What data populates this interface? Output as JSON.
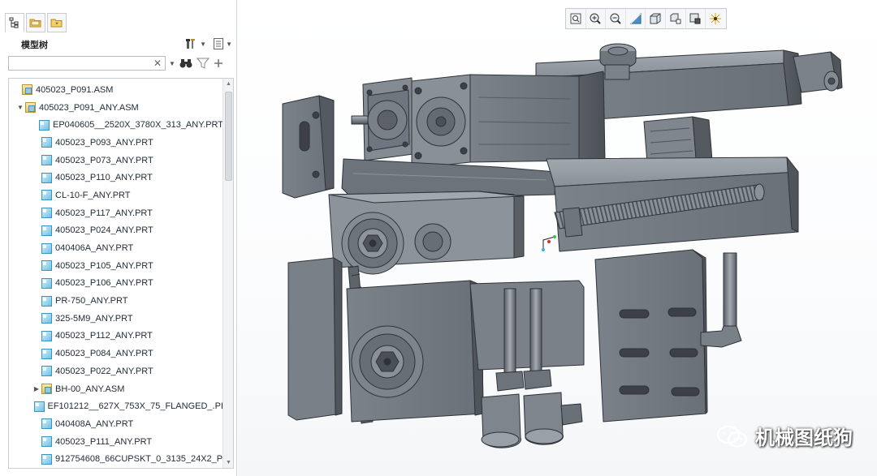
{
  "panel": {
    "tree_title": "模型树",
    "search_placeholder": "",
    "tabs": [
      {
        "icon": "model-tree-icon",
        "active": true
      },
      {
        "icon": "folder-browser-icon",
        "active": false
      },
      {
        "icon": "favorites-icon",
        "active": false
      }
    ]
  },
  "tree": {
    "items": [
      {
        "label": "405023_P091.ASM",
        "type": "asm",
        "level": 0,
        "twisty": ""
      },
      {
        "label": "405023_P091_ANY.ASM",
        "type": "asm",
        "level": 1,
        "twisty": "expanded"
      },
      {
        "label": "EP040605__2520X_3780X_313_ANY.PRT",
        "type": "prt",
        "level": 2,
        "twisty": ""
      },
      {
        "label": "405023_P093_ANY.PRT",
        "type": "prt",
        "level": 2,
        "twisty": ""
      },
      {
        "label": "405023_P073_ANY.PRT",
        "type": "prt",
        "level": 2,
        "twisty": ""
      },
      {
        "label": "405023_P110_ANY.PRT",
        "type": "prt",
        "level": 2,
        "twisty": ""
      },
      {
        "label": "CL-10-F_ANY.PRT",
        "type": "prt",
        "level": 2,
        "twisty": ""
      },
      {
        "label": "405023_P117_ANY.PRT",
        "type": "prt",
        "level": 2,
        "twisty": ""
      },
      {
        "label": "405023_P024_ANY.PRT",
        "type": "prt",
        "level": 2,
        "twisty": ""
      },
      {
        "label": "040406A_ANY.PRT",
        "type": "prt",
        "level": 2,
        "twisty": ""
      },
      {
        "label": "405023_P105_ANY.PRT",
        "type": "prt",
        "level": 2,
        "twisty": ""
      },
      {
        "label": "405023_P106_ANY.PRT",
        "type": "prt",
        "level": 2,
        "twisty": ""
      },
      {
        "label": "PR-750_ANY.PRT",
        "type": "prt",
        "level": 2,
        "twisty": ""
      },
      {
        "label": "325-5M9_ANY.PRT",
        "type": "prt",
        "level": 2,
        "twisty": ""
      },
      {
        "label": "405023_P112_ANY.PRT",
        "type": "prt",
        "level": 2,
        "twisty": ""
      },
      {
        "label": "405023_P084_ANY.PRT",
        "type": "prt",
        "level": 2,
        "twisty": ""
      },
      {
        "label": "405023_P022_ANY.PRT",
        "type": "prt",
        "level": 2,
        "twisty": ""
      },
      {
        "label": "BH-00_ANY.ASM",
        "type": "asm",
        "level": 2,
        "twisty": "collapsed"
      },
      {
        "label": "EF101212__627X_753X_75_FLANGED_.PI",
        "type": "prt",
        "level": 2,
        "twisty": ""
      },
      {
        "label": "040408A_ANY.PRT",
        "type": "prt",
        "level": 2,
        "twisty": ""
      },
      {
        "label": "405023_P111_ANY.PRT",
        "type": "prt",
        "level": 2,
        "twisty": ""
      },
      {
        "label": "912754608_66CUPSKT_0_3135_24X2_P",
        "type": "prt",
        "level": 2,
        "twisty": ""
      }
    ]
  },
  "view_toolbar": {
    "buttons": [
      "refit-icon",
      "zoom-in-icon",
      "zoom-out-icon",
      "repaint-icon",
      "display-style-icon",
      "saved-views-icon",
      "view-manager-icon",
      "spin-center-icon"
    ]
  },
  "watermark": {
    "text": "机械图纸狗"
  },
  "colors": {
    "model_light": "#8c929a",
    "model_mid": "#6f757d",
    "model_dark": "#4a4f56",
    "tree_text": "#1f2a36"
  }
}
